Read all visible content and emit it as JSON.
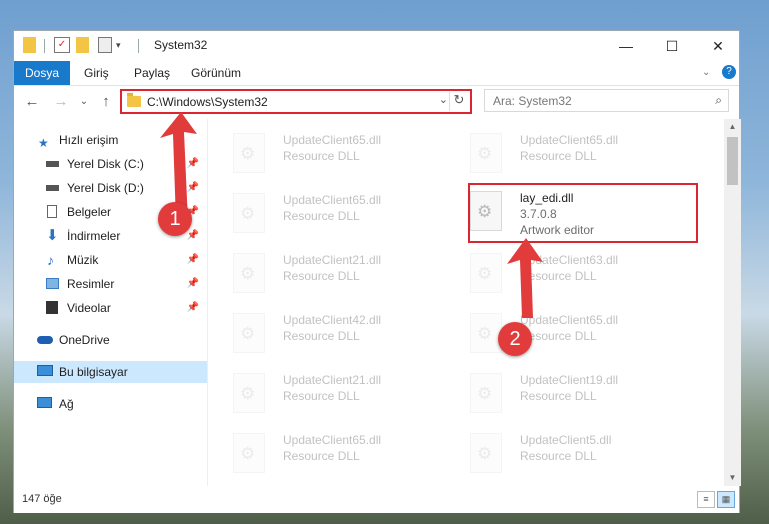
{
  "window": {
    "title": "System32",
    "controls": {
      "minimize": "—",
      "maximize": "☐",
      "close": "✕"
    }
  },
  "ribbon": {
    "file_tab": "Dosya",
    "tabs": [
      "Giriş",
      "Paylaş",
      "Görünüm"
    ],
    "help": "?"
  },
  "navbar": {
    "back": "←",
    "forward": "→",
    "recent": "⌄",
    "up": "↑",
    "address": "C:\\Windows\\System32",
    "dropdown": "⌄",
    "refresh": "↻",
    "search_placeholder": "Ara: System32",
    "search_icon": "⌕"
  },
  "sidebar": {
    "quick_access": "Hızlı erişim",
    "items": [
      {
        "label": "Yerel Disk (C:)",
        "icon": "drive-icon",
        "pinned": true
      },
      {
        "label": "Yerel Disk (D:)",
        "icon": "drive-icon",
        "pinned": true
      },
      {
        "label": "Belgeler",
        "icon": "documents-icon",
        "pinned": true
      },
      {
        "label": "İndirmeler",
        "icon": "download-icon",
        "pinned": true
      },
      {
        "label": "Müzik",
        "icon": "music-icon",
        "pinned": true
      },
      {
        "label": "Resimler",
        "icon": "pictures-icon",
        "pinned": true
      },
      {
        "label": "Videolar",
        "icon": "videos-icon",
        "pinned": true
      }
    ],
    "onedrive": "OneDrive",
    "this_pc": "Bu bilgisayar",
    "network": "Ağ"
  },
  "files": {
    "left_column": [
      {
        "name": "UpdateClient65.dll",
        "type": "Resource DLL"
      },
      {
        "name": "UpdateClient65.dll",
        "type": "Resource DLL"
      },
      {
        "name": "UpdateClient21.dll",
        "type": "Resource DLL"
      },
      {
        "name": "UpdateClient42.dll",
        "type": "Resource DLL"
      },
      {
        "name": "UpdateClient21.dll",
        "type": "Resource DLL"
      },
      {
        "name": "UpdateClient65.dll",
        "type": "Resource DLL"
      }
    ],
    "right_column": [
      {
        "name": "UpdateClient65.dll",
        "type": "Resource DLL"
      },
      {
        "name": "UpdateClient63.dll",
        "type": "Resource DLL"
      },
      {
        "name": "UpdateClient65.dll",
        "type": "Resource DLL"
      },
      {
        "name": "UpdateClient19.dll",
        "type": "Resource DLL"
      },
      {
        "name": "UpdateClient5.dll",
        "type": "Resource DLL"
      }
    ],
    "featured": {
      "name": "lay_edi.dll",
      "version": "3.7.0.8",
      "description": "Artwork editor"
    }
  },
  "status": {
    "count": "147 öğe"
  },
  "annotations": {
    "step1": "1",
    "step2": "2",
    "color": "#e23b3b"
  }
}
